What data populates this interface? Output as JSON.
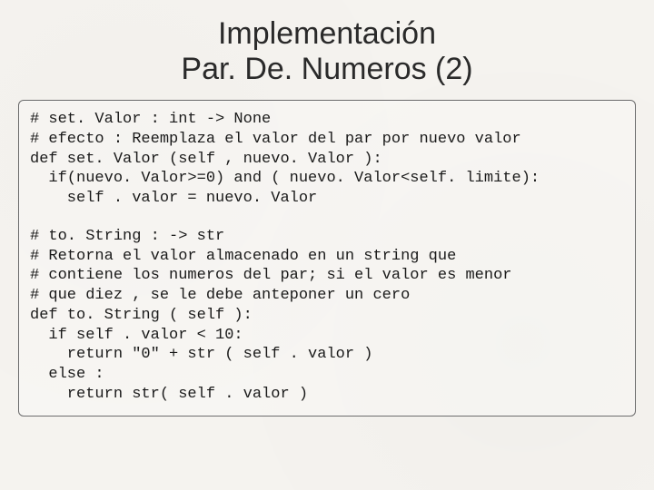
{
  "title_line1": "Implementación",
  "title_line2": "Par. De. Numeros (2)",
  "code_block1": "# set. Valor : int -> None\n# efecto : Reemplaza el valor del par por nuevo valor\ndef set. Valor (self , nuevo. Valor ):\n  if(nuevo. Valor>=0) and ( nuevo. Valor<self. limite):\n    self . valor = nuevo. Valor",
  "code_block2": "# to. String : -> str\n# Retorna el valor almacenado en un string que\n# contiene los numeros del par; si el valor es menor\n# que diez , se le debe anteponer un cero\ndef to. String ( self ):\n  if self . valor < 10:\n    return \"0\" + str ( self . valor )\n  else :\n    return str( self . valor )"
}
